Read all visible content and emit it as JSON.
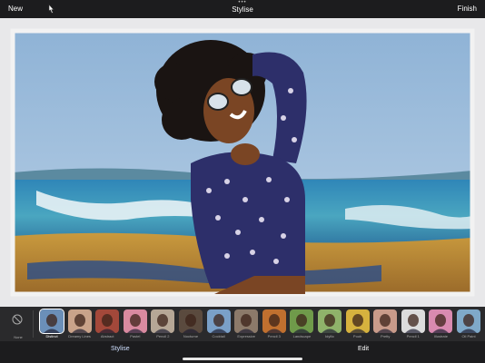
{
  "topbar": {
    "new_label": "New",
    "title": "Stylise",
    "dots": "•••",
    "finish_label": "Finish"
  },
  "canvas": {
    "image_description": "painted photo of woman with sunglasses on beach"
  },
  "filmstrip": {
    "none_label": "None",
    "styles": [
      {
        "label": "Distinct",
        "selected": true,
        "color": "#6b8fb8"
      },
      {
        "label": "Dreamy Lines",
        "selected": false,
        "color": "#c9a38a"
      },
      {
        "label": "Abstract",
        "selected": false,
        "color": "#a3483a"
      },
      {
        "label": "Pastel",
        "selected": false,
        "color": "#d98aa0"
      },
      {
        "label": "Pencil 2",
        "selected": false,
        "color": "#b6a796"
      },
      {
        "label": "Nocturne",
        "selected": false,
        "color": "#5a4a3e"
      },
      {
        "label": "Cocktail",
        "selected": false,
        "color": "#7aa0c8"
      },
      {
        "label": "Expressive",
        "selected": false,
        "color": "#8c7a6a"
      },
      {
        "label": "Pencil 3",
        "selected": false,
        "color": "#c0702f"
      },
      {
        "label": "Landscape",
        "selected": false,
        "color": "#6f9a4a"
      },
      {
        "label": "Idyllic",
        "selected": false,
        "color": "#8fb26a"
      },
      {
        "label": "Pooh",
        "selected": false,
        "color": "#d6b23e"
      },
      {
        "label": "Pretty",
        "selected": false,
        "color": "#c99b8a"
      },
      {
        "label": "Pencil 1",
        "selected": false,
        "color": "#dcdcdc"
      },
      {
        "label": "Illustrate",
        "selected": false,
        "color": "#d98ab0"
      },
      {
        "label": "Oil Paint",
        "selected": false,
        "color": "#7fa9c9"
      }
    ]
  },
  "bottombar": {
    "tab_stylise": "Stylise",
    "tab_edit": "Edit"
  }
}
